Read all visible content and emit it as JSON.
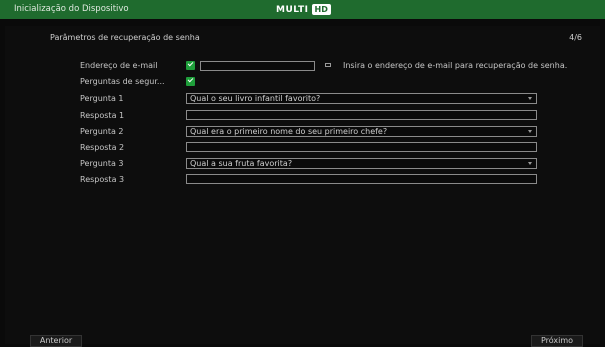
{
  "window": {
    "title": "Inicialização do Dispositivo",
    "brand_left": "MULTI",
    "brand_right": "HD"
  },
  "page": {
    "section_title": "Parâmetros de recuperação de senha",
    "step": "4/6"
  },
  "form": {
    "email": {
      "label": "Endereço de e-mail",
      "checked": true,
      "value": "",
      "hint": "Insira o endereço de e-mail para recuperação de senha."
    },
    "security_questions": {
      "label": "Perguntas de segur...",
      "checked": true
    },
    "questions": [
      {
        "label": "Pergunta 1",
        "selected": "Qual o seu livro infantil favorito?",
        "answer_label": "Resposta 1",
        "answer": ""
      },
      {
        "label": "Pergunta 2",
        "selected": "Qual era o primeiro nome do seu primeiro chefe?",
        "answer_label": "Resposta 2",
        "answer": ""
      },
      {
        "label": "Pergunta 3",
        "selected": "Qual a sua fruta favorita?",
        "answer_label": "Resposta 3",
        "answer": ""
      }
    ]
  },
  "footer": {
    "back_label": "Anterior",
    "next_label": "Próximo"
  },
  "colors": {
    "titlebar": "#1f6b2e",
    "checkbox": "#1e9e3a"
  }
}
